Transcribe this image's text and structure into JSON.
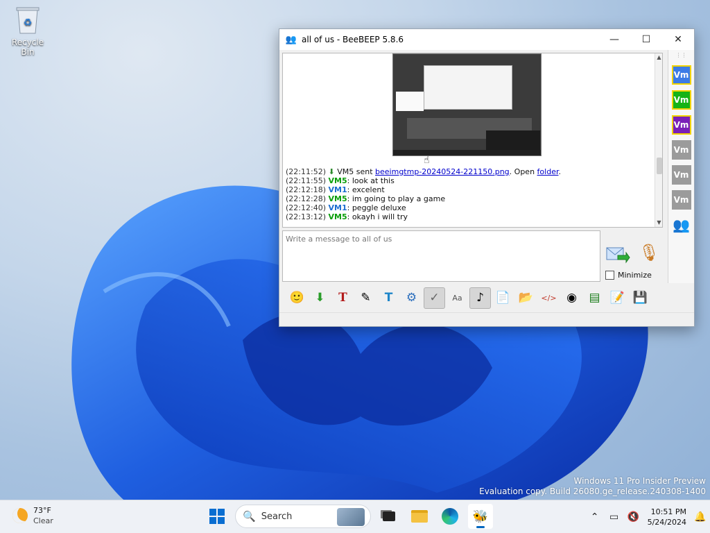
{
  "desktop": {
    "recycle_bin_label": "Recycle Bin",
    "watermark_line1": "Windows 11 Pro Insider Preview",
    "watermark_line2": "Evaluation copy. Build 26080.ge_release.240308-1400"
  },
  "window": {
    "title": "all of us - BeeBEEP 5.8.6",
    "input_placeholder": "Write a message to all of us",
    "minimize_label": "Minimize",
    "file_event": {
      "time": "(22:11:52)",
      "sender": "VM5",
      "text_sent": "sent",
      "filename": "beeimgtmp-20240524-221150.png",
      "text_open": ". Open",
      "folder_link": "folder",
      "text_end": "."
    },
    "messages": [
      {
        "time": "(22:11:55)",
        "user": "VM5",
        "text": "look at this"
      },
      {
        "time": "(22:12:18)",
        "user": "VM1",
        "text": "excelent"
      },
      {
        "time": "(22:12:28)",
        "user": "VM5",
        "text": "im going to play a game"
      },
      {
        "time": "(22:12:40)",
        "user": "VM1",
        "text": "peggle deluxe"
      },
      {
        "time": "(22:13:12)",
        "user": "VM5",
        "text": "okayh i will try"
      }
    ],
    "user_buttons": [
      {
        "label": "Vm",
        "bg": "#3b7be6",
        "border": "#f2d400"
      },
      {
        "label": "Vm",
        "bg": "#17b317",
        "border": "#f2d400"
      },
      {
        "label": "Vm",
        "bg": "#7a1fb8",
        "border": "#f2d400"
      },
      {
        "label": "Vm",
        "bg": "#9b9b9b",
        "border": "transparent"
      },
      {
        "label": "Vm",
        "bg": "#9b9b9b",
        "border": "transparent"
      },
      {
        "label": "Vm",
        "bg": "#9b9b9b",
        "border": "transparent"
      }
    ]
  },
  "taskbar": {
    "temp": "73°F",
    "condition": "Clear",
    "search_label": "Search",
    "time": "10:51 PM",
    "date": "5/24/2024"
  },
  "colors": {
    "vm5": "#0a9e0a",
    "vm1": "#1c6dd0",
    "link": "#0000cc",
    "accent": "#0067c0"
  }
}
